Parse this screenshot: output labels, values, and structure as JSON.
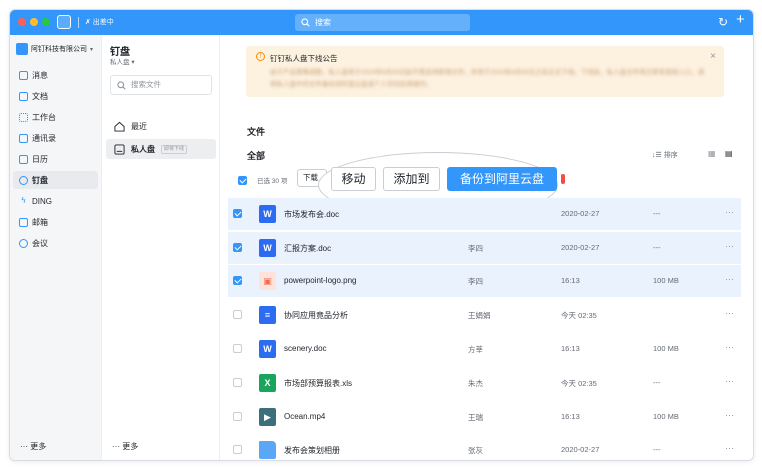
{
  "titlebar": {
    "status": "✗ 出差中",
    "search_placeholder": "搜索"
  },
  "sidebar": {
    "org_name": "阿钉科技有限公司",
    "items": [
      {
        "label": "消息",
        "icon": "message-icon"
      },
      {
        "label": "文档",
        "icon": "document-icon"
      },
      {
        "label": "工作台",
        "icon": "workbench-icon"
      },
      {
        "label": "通讯录",
        "icon": "contacts-icon"
      },
      {
        "label": "日历",
        "icon": "calendar-icon"
      },
      {
        "label": "钉盘",
        "icon": "cloud-icon",
        "active": true
      },
      {
        "label": "DING",
        "icon": "ding-icon"
      },
      {
        "label": "邮箱",
        "icon": "mail-icon"
      },
      {
        "label": "会议",
        "icon": "meeting-icon"
      }
    ],
    "more": "更多"
  },
  "disk_nav": {
    "title": "钉盘",
    "subtitle": "私人盘",
    "search_placeholder": "搜索文件",
    "items": [
      {
        "label": "最近",
        "icon": "home-icon"
      },
      {
        "label": "私人盘",
        "badge": "即将下线",
        "icon": "drive-icon",
        "active": true
      }
    ],
    "more": "更多"
  },
  "notice": {
    "title": "钉钉私人盘下线公告",
    "body": "由于产品策略调整，私人盘将于2024年6月30日起不再支持新增文件，并将于2024年6月30日之后正式下线。下线后，私人盘文件将迁移至其他入口，请将私人盘中的文件备份到阿里云盘或个人空间后再操作。"
  },
  "files": {
    "section_label": "文件",
    "all_label": "全部",
    "sort_label": "排序",
    "selected_count": "已选 30 项",
    "download_label": "下载",
    "actions": {
      "move": "移动",
      "add_to": "添加到",
      "backup": "备份到阿里云盘"
    },
    "rows": [
      {
        "name": "市场发布会.doc",
        "owner": "",
        "time": "2020-02-27",
        "size": "---",
        "type": "word",
        "checked": true
      },
      {
        "name": "汇报方案.doc",
        "owner": "李四",
        "time": "2020-02-27",
        "size": "---",
        "type": "word",
        "checked": true
      },
      {
        "name": "powerpoint-logo.png",
        "owner": "李四",
        "time": "16:13",
        "size": "100 MB",
        "type": "image",
        "checked": true
      },
      {
        "name": "协同应用竟品分析",
        "owner": "王娟娟",
        "time": "今天 02:35",
        "size": "",
        "type": "doc",
        "checked": false
      },
      {
        "name": "scenery.doc",
        "owner": "方莘",
        "time": "16:13",
        "size": "100 MB",
        "type": "word",
        "checked": false
      },
      {
        "name": "市场部预算报表.xls",
        "owner": "朱杰",
        "time": "今天 02:35",
        "size": "---",
        "type": "excel",
        "checked": false
      },
      {
        "name": "Ocean.mp4",
        "owner": "王瑞",
        "time": "16:13",
        "size": "100 MB",
        "type": "video",
        "checked": false
      },
      {
        "name": "发布会策划相册",
        "owner": "张灰",
        "time": "2020-02-27",
        "size": "---",
        "type": "folder",
        "checked": false
      }
    ]
  },
  "colors": {
    "accent": "#3296fa",
    "selected_row": "#eaf2fd",
    "notice_bg": "#fdf1df",
    "word": "#2b6cf2",
    "excel": "#1aa55c",
    "image": "#ee6c4d",
    "video": "#3b6f7c",
    "folder": "#5aa8f5"
  }
}
